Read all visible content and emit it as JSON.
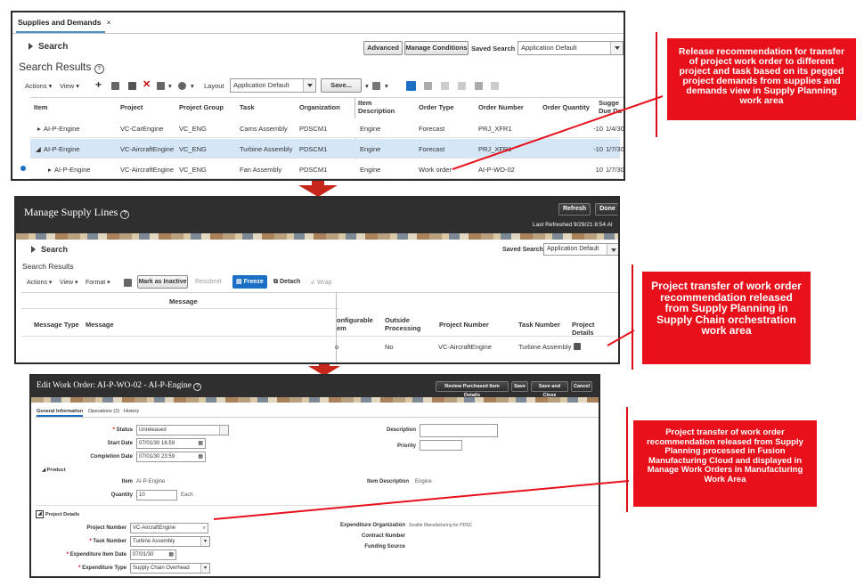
{
  "panel1": {
    "tab_label": "Supplies and Demands",
    "tab_close": "×",
    "search_label": "Search",
    "advanced_btn": "Advanced",
    "manage_conditions_btn": "Manage Conditions",
    "saved_search_label": "Saved Search",
    "saved_search_value": "Application Default",
    "results_title": "Search Results",
    "actions_menu": "Actions ▾",
    "view_menu": "View ▾",
    "layout_label": "Layout",
    "layout_value": "Application Default",
    "save_btn": "Save...",
    "headers": [
      "Item",
      "Project",
      "Project Group",
      "Task",
      "Organization",
      "Item Description",
      "Order Type",
      "Order Number",
      "Order Quantity",
      "Sugge Due Da"
    ],
    "rows": [
      {
        "item": "AI-P-Engine",
        "project": "VC-CarEngine",
        "group": "VC_ENG",
        "task": "Cams Assembly",
        "org": "PDSCM1",
        "desc": "Engine",
        "type": "Forecast",
        "number": "PRJ_XFR1",
        "qty": "-10",
        "due": "1/4/30"
      },
      {
        "item": "AI-P-Engine",
        "project": "VC-AircraftEngine",
        "group": "VC_ENG",
        "task": "Turbine Assembly",
        "org": "PDSCM1",
        "desc": "Engine",
        "type": "Forecast",
        "number": "PRJ_XFR1",
        "qty": "-10",
        "due": "1/7/30"
      },
      {
        "item": "AI-P-Engine",
        "project": "VC-AircraftEngine",
        "group": "VC_ENG",
        "task": "Fan Assembly",
        "org": "PDSCM1",
        "desc": "Engine",
        "type": "Work order",
        "number": "AI-P-WO-02",
        "qty": "10",
        "due": "1/7/30"
      }
    ]
  },
  "callout1": "Release recommendation for transfer of project work order to different project and task based on its pegged project demands from supplies and demands view in Supply Planning work area",
  "panel2": {
    "title": "Manage Supply Lines",
    "refresh_btn": "Refresh",
    "done_btn": "Done",
    "last_refreshed": "Last Refreshed 9/29/21 8:54 AI",
    "search_label": "Search",
    "saved_search_label": "Saved Search",
    "saved_search_value": "Application Default",
    "results_title": "Search Results",
    "actions_menu": "Actions ▾",
    "view_menu": "View ▾",
    "format_menu": "Format ▾",
    "mark_inactive_btn": "Mark as Inactive",
    "resubmit_btn": "Resubmit",
    "freeze_btn": "Freeze",
    "detach_btn": "Detach",
    "wrap_btn": "Wrap",
    "message_group_header": "Message",
    "col_message_type": "Message Type",
    "col_message": "Message",
    "col_configurable_1": "onfigurable",
    "col_configurable_2": "em",
    "col_outside_1": "Outside",
    "col_outside_2": "Processing",
    "col_project_number": "Project Number",
    "col_task_number": "Task Number",
    "col_project_details": "Project Details",
    "row_configurable": "o",
    "row_outside": "No",
    "row_project_number": "VC-AircraftEngine",
    "row_task_number": "Turbine Assembly"
  },
  "callout2": "Project transfer of work order recommendation released from Supply Planning in Supply Chain orchestration work area",
  "panel3": {
    "title": "Edit Work Order: AI-P-WO-02 - AI-P-Engine",
    "review_btn": "Review Purchased Item Details",
    "save_btn": "Save",
    "save_close_btn": "Save and Close",
    "cancel_btn": "Cancel",
    "tab_general": "General Information",
    "tab_operations": "Operations (2)",
    "tab_history": "History",
    "status_label": "Status",
    "status_value": "Unreleased",
    "start_date_label": "Start Date",
    "start_date_value": "07/01/30 16:59",
    "completion_date_label": "Completion Date",
    "completion_date_value": "07/01/30 23:59",
    "description_label": "Description",
    "priority_label": "Priority",
    "product_section": "Product",
    "item_label": "Item",
    "item_value": "AI-P-Engine",
    "item_desc_label": "Item Description",
    "item_desc_value": "Engine",
    "quantity_label": "Quantity",
    "quantity_value": "10",
    "quantity_uom": "Each",
    "project_section": "Project Details",
    "project_number_label": "Project Number",
    "project_number_value": "VC-AircraftEngine",
    "task_number_label": "Task Number",
    "task_number_value": "Turbine Assembly",
    "exp_item_date_label": "Expenditure Item Date",
    "exp_item_date_value": "07/01/30",
    "exp_type_label": "Expenditure Type",
    "exp_type_value": "Supply Chain Overhead",
    "exp_org_label": "Expenditure Organization",
    "exp_org_value": "Seattle Manufacturing for PDSC",
    "contract_label": "Contract Number",
    "funding_label": "Funding Source"
  },
  "callout3": "Project transfer of work order recommendation released from Supply Planning processed in Fusion Manufacturing Cloud and displayed in Manage Work Orders in Manufacturing Work Area",
  "colors": {
    "callout_red": "#e8101a",
    "header_dark": "#2f2f2f",
    "accent_blue": "#1a6fc4"
  }
}
